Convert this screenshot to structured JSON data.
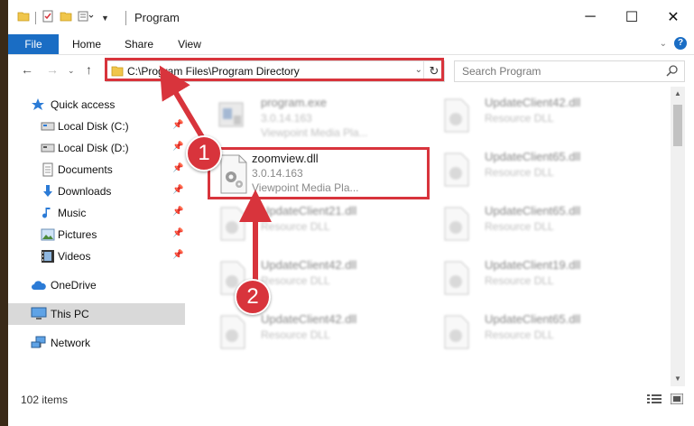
{
  "window": {
    "title": "Program",
    "controls": {
      "minimize": "─",
      "maximize": "☐",
      "close": "✕"
    }
  },
  "ribbon": {
    "tabs": [
      "File",
      "Home",
      "Share",
      "View"
    ]
  },
  "address_bar": {
    "path": "C:\\Program Files\\Program Directory",
    "search_placeholder": "Search Program"
  },
  "sidebar": {
    "items": [
      {
        "label": "Quick access",
        "icon": "star-icon",
        "pinned": false
      },
      {
        "label": "Local Disk (C:)",
        "icon": "drive-icon",
        "pinned": true
      },
      {
        "label": "Local Disk (D:)",
        "icon": "drive-icon",
        "pinned": true
      },
      {
        "label": "Documents",
        "icon": "documents-icon",
        "pinned": true
      },
      {
        "label": "Downloads",
        "icon": "download-icon",
        "pinned": true
      },
      {
        "label": "Music",
        "icon": "music-icon",
        "pinned": true
      },
      {
        "label": "Pictures",
        "icon": "pictures-icon",
        "pinned": true
      },
      {
        "label": "Videos",
        "icon": "videos-icon",
        "pinned": true
      },
      {
        "label": "OneDrive",
        "icon": "cloud-icon",
        "pinned": false
      },
      {
        "label": "This PC",
        "icon": "computer-icon",
        "pinned": false,
        "selected": true
      },
      {
        "label": "Network",
        "icon": "network-icon",
        "pinned": false
      }
    ]
  },
  "files": {
    "left_column": [
      {
        "name": "program.exe",
        "version": "3.0.14.163",
        "description": "Viewpoint Media Pla..."
      },
      {
        "name": "zoomview.dll",
        "version": "3.0.14.163",
        "description": "Viewpoint Media Pla..."
      },
      {
        "name": "UpdateClient21.dll",
        "version": "Resource DLL",
        "description": ""
      },
      {
        "name": "UpdateClient42.dll",
        "version": "Resource DLL",
        "description": ""
      },
      {
        "name": "UpdateClient42.dll",
        "version": "Resource DLL",
        "description": ""
      }
    ],
    "right_column": [
      {
        "name": "UpdateClient42.dll",
        "version": "Resource DLL"
      },
      {
        "name": "UpdateClient65.dll",
        "version": "Resource DLL"
      },
      {
        "name": "UpdateClient65.dll",
        "version": "Resource DLL"
      },
      {
        "name": "UpdateClient19.dll",
        "version": "Resource DLL"
      },
      {
        "name": "UpdateClient65.dll",
        "version": "Resource DLL"
      }
    ]
  },
  "annotations": {
    "step1": "1",
    "step2": "2",
    "highlight_color": "#d8343c"
  },
  "status": {
    "item_count": "102 items"
  },
  "colors": {
    "accent": "#1a6dc4",
    "selection": "#d9d9d9"
  }
}
